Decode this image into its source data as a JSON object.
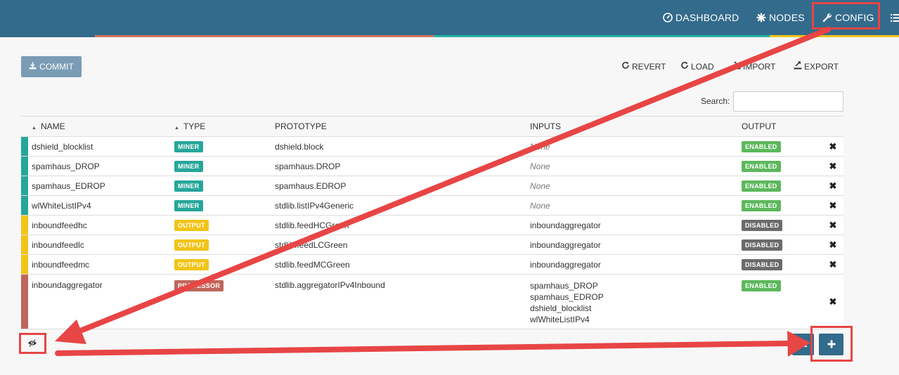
{
  "nav": {
    "dashboard": "DASHBOARD",
    "nodes": "NODES",
    "config": "CONFIG"
  },
  "toolbar": {
    "commit": "COMMIT",
    "revert": "REVERT",
    "load": "LOAD",
    "import": "IMPORT",
    "export": "EXPORT"
  },
  "search": {
    "label": "Search:",
    "value": ""
  },
  "table": {
    "headers": {
      "name": "NAME",
      "type": "TYPE",
      "prototype": "PROTOTYPE",
      "inputs": "INPUTS",
      "output": "OUTPUT"
    },
    "rows": [
      {
        "name": "dshield_blocklist",
        "type": "MINER",
        "prototype": "dshield.block",
        "inputs": [
          "None"
        ],
        "output": "ENABLED"
      },
      {
        "name": "spamhaus_DROP",
        "type": "MINER",
        "prototype": "spamhaus.DROP",
        "inputs": [
          "None"
        ],
        "output": "ENABLED"
      },
      {
        "name": "spamhaus_EDROP",
        "type": "MINER",
        "prototype": "spamhaus.EDROP",
        "inputs": [
          "None"
        ],
        "output": "ENABLED"
      },
      {
        "name": "wlWhiteListIPv4",
        "type": "MINER",
        "prototype": "stdlib.listIPv4Generic",
        "inputs": [
          "None"
        ],
        "output": "ENABLED"
      },
      {
        "name": "inboundfeedhc",
        "type": "OUTPUT",
        "prototype": "stdlib.feedHCGreen",
        "inputs": [
          "inboundaggregator"
        ],
        "output": "DISABLED"
      },
      {
        "name": "inboundfeedlc",
        "type": "OUTPUT",
        "prototype": "stdlib.feedLCGreen",
        "inputs": [
          "inboundaggregator"
        ],
        "output": "DISABLED"
      },
      {
        "name": "inboundfeedmc",
        "type": "OUTPUT",
        "prototype": "stdlib.feedMCGreen",
        "inputs": [
          "inboundaggregator"
        ],
        "output": "DISABLED"
      },
      {
        "name": "inboundaggregator",
        "type": "PROCESSOR",
        "prototype": "stdlib.aggregatorIPv4Inbound",
        "inputs": [
          "spamhaus_DROP",
          "spamhaus_EDROP",
          "dshield_blocklist",
          "wlWhiteListIPv4"
        ],
        "output": "ENABLED"
      }
    ]
  },
  "colors": {
    "navbar": "#336b8c",
    "miner": "#26a69a",
    "output": "#f2c418",
    "processor": "#c0665b",
    "enabled": "#5cb85c",
    "disabled": "#6b6b6b",
    "annotation": "#e84545"
  },
  "icons": {
    "dashboard": "dashboard-icon",
    "nodes": "nodes-icon",
    "config": "wrench-icon",
    "menu": "list-menu-icon",
    "commit": "download-icon",
    "revert": "refresh-icon",
    "load": "refresh-icon",
    "import": "import-icon",
    "export": "export-icon",
    "delete": "close-icon",
    "toggle": "eye-slash-icon",
    "list": "list-icon",
    "add": "plus-icon"
  }
}
